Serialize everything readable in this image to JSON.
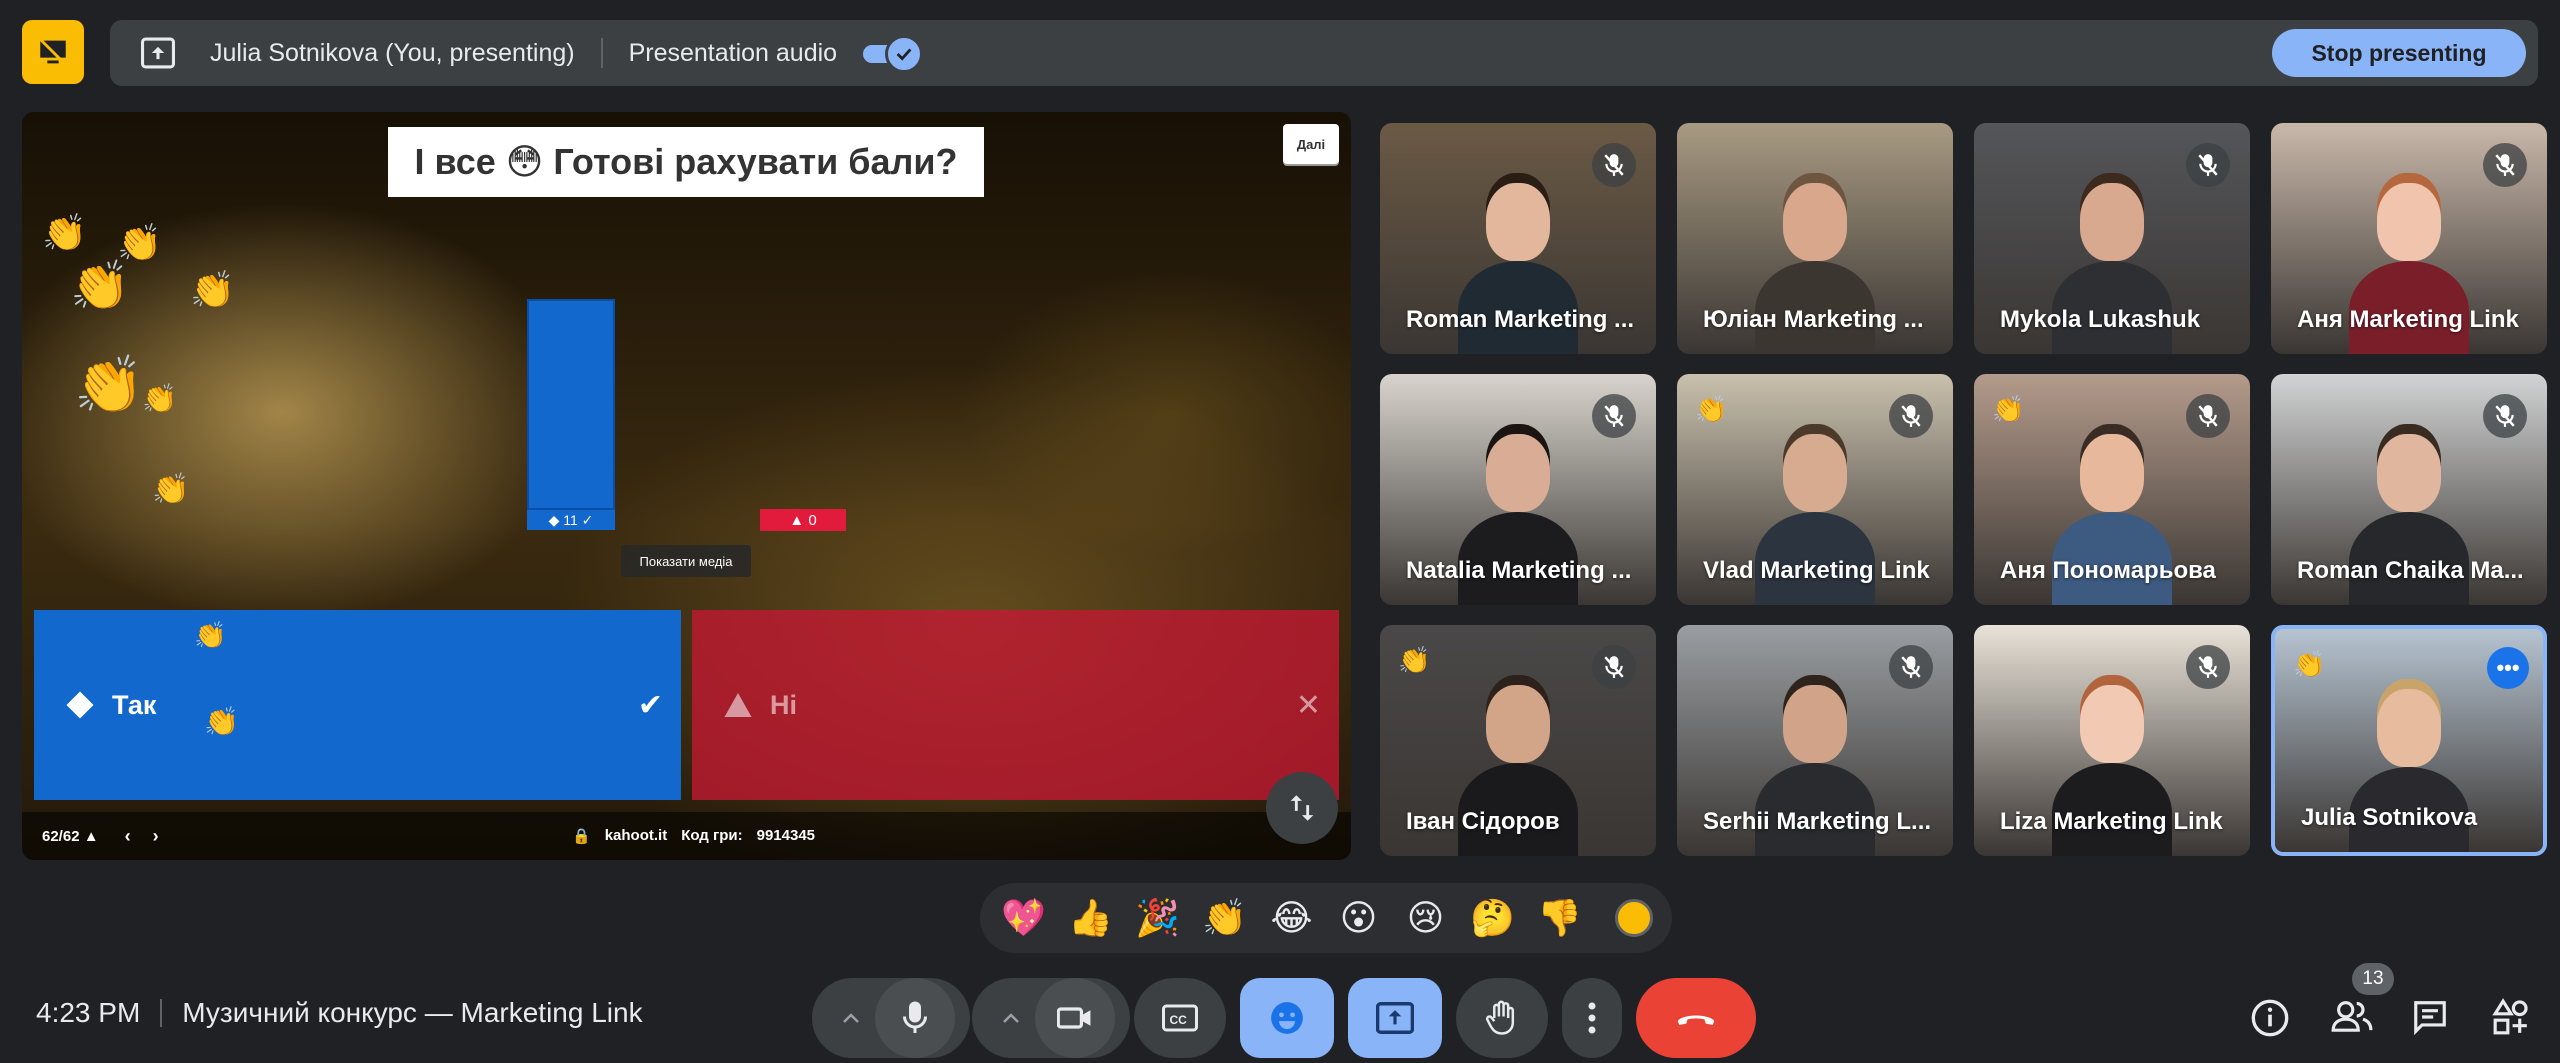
{
  "topbar": {
    "presenter_label": "Julia Sotnikova (You, presenting)",
    "audio_label": "Presentation audio",
    "audio_enabled": true,
    "stop_label": "Stop presenting"
  },
  "presentation": {
    "question": "І все 😳 Готові рахувати бали?",
    "next_label": "Далі",
    "blue_bar_label": "◆ 11 ✓",
    "red_bar_label": "▲ 0",
    "media_button": "Показати медіа",
    "answers": [
      {
        "text": "Так",
        "shape": "diamond",
        "mark": "✔",
        "correct": true
      },
      {
        "text": "Ні",
        "shape": "triangle",
        "mark": "✕",
        "correct": false
      }
    ],
    "counter": "62/62 ▲",
    "site": "kahoot.it",
    "game_pin_label": "Код гри:",
    "game_pin": "9914345"
  },
  "participants": [
    {
      "name": "Roman Marketing ...",
      "muted": true,
      "hand": false,
      "bg": "#6b5a45",
      "skin": "#e2b79b",
      "hair": "#2a1d14",
      "shirt": "#1f2a33"
    },
    {
      "name": "Юліан Marketing ...",
      "muted": false,
      "hand": false,
      "bg": "#a89a82",
      "skin": "#d9a88c",
      "hair": "#6d5540",
      "shirt": "#3b3630"
    },
    {
      "name": "Mykola Lukashuk",
      "muted": true,
      "hand": false,
      "bg": "#55565a",
      "skin": "#d8a98f",
      "hair": "#3c2a1f",
      "shirt": "#2e2f33"
    },
    {
      "name": "Аня Marketing Link",
      "muted": true,
      "hand": false,
      "bg": "#c9b8aa",
      "skin": "#f0c4ad",
      "hair": "#b5673e",
      "shirt": "#7a1f2a"
    },
    {
      "name": "Natalia Marketing ...",
      "muted": true,
      "hand": false,
      "bg": "#d8d4cd",
      "skin": "#d9ad95",
      "hair": "#1b1511",
      "shirt": "#1c1c1f"
    },
    {
      "name": "Vlad Marketing Link",
      "muted": true,
      "hand": true,
      "bg": "#c9c0ad",
      "skin": "#d7ab8f",
      "hair": "#4b3a2a",
      "shirt": "#2c3440"
    },
    {
      "name": "Аня Пономарьова",
      "muted": true,
      "hand": true,
      "bg": "#b49b8b",
      "skin": "#e8b89c",
      "hair": "#3a2c24",
      "shirt": "#3d5a80"
    },
    {
      "name": "Roman Chaika Ma...",
      "muted": true,
      "hand": false,
      "bg": "#d2d3d4",
      "skin": "#e0b79e",
      "hair": "#3a2b20",
      "shirt": "#26282b"
    },
    {
      "name": "Іван Сідоров",
      "muted": true,
      "hand": true,
      "bg": "#4a4848",
      "skin": "#d2a488",
      "hair": "#2d221b",
      "shirt": "#1a1a1c"
    },
    {
      "name": "Serhii Marketing L...",
      "muted": true,
      "hand": false,
      "bg": "#9a9ea2",
      "skin": "#d1a48a",
      "hair": "#2f241c",
      "shirt": "#2a2b2e"
    },
    {
      "name": "Liza Marketing Link",
      "muted": true,
      "hand": false,
      "bg": "#e8e2d8",
      "skin": "#f2c9b3",
      "hair": "#b2643c",
      "shirt": "#1c1c1e"
    },
    {
      "name": "Julia Sotnikova",
      "muted": false,
      "hand": true,
      "bg": "#b6c4d1",
      "skin": "#e6bb9e",
      "hair": "#c9a46a",
      "shirt": "#2a2a2e",
      "active": true
    }
  ],
  "reactions": [
    "💖",
    "👍",
    "🎉",
    "👏",
    "😂",
    "😮",
    "😢",
    "🤔",
    "👎"
  ],
  "meeting": {
    "time": "4:23 PM",
    "title": "Музичний конкурс — Marketing Link"
  },
  "people_count": "13",
  "colors": {
    "accent": "#8ab4f8",
    "end_call": "#ea4335",
    "present_icon": "#fbbc04",
    "kahoot_blue": "#1368ce",
    "kahoot_red": "#e21b3c"
  }
}
